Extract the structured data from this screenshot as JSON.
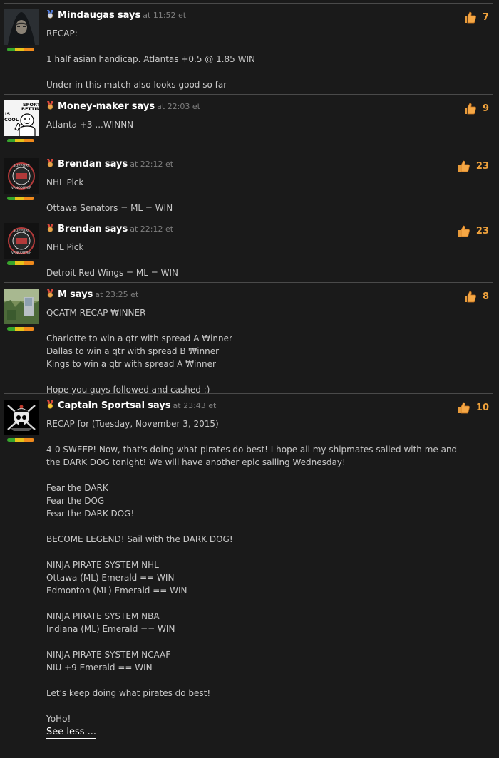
{
  "says_word": "says",
  "time_prefix": "at",
  "time_suffix": "et",
  "see_less_label": "See less ...",
  "colors": {
    "background": "#1a1a1a",
    "text": "#c9c9c9",
    "like_count": "#f0a23c",
    "rank_bar": [
      "#38a52c",
      "#e6c21a",
      "#f08a1c"
    ]
  },
  "comments": [
    {
      "author": "Mindaugas",
      "medal_icon": "silver-medal-icon",
      "time": "11:52",
      "likes": "7",
      "avatar_icon": "hooded-figure-avatar",
      "lines": [
        "RECAP:",
        "",
        "1 half asian handicap. Atlantas +0.5 @ 1.85 WIN",
        "",
        "Under in this match also looks good so far"
      ]
    },
    {
      "author": "Money-maker",
      "medal_icon": "bronze-medal-icon",
      "time": "22:03",
      "likes": "9",
      "avatar_icon": "sports-betting-cartoon-avatar",
      "avatar_text": [
        "SPORTS",
        "BETTING",
        "IS",
        "COOL"
      ],
      "lines": [
        "Atlanta +3 ...WINNN"
      ]
    },
    {
      "author": "Brendan",
      "medal_icon": "bronze-medal-icon",
      "time": "22:12",
      "likes": "23",
      "avatar_icon": "support-vancouver-badge-avatar",
      "lines": [
        "NHL Pick",
        "",
        "Ottawa Senators = ML = WIN"
      ]
    },
    {
      "author": "Brendan",
      "medal_icon": "bronze-medal-icon",
      "time": "22:12",
      "likes": "23",
      "avatar_icon": "support-vancouver-badge-avatar",
      "lines": [
        "NHL Pick",
        "",
        "Detroit Red Wings = ML = WIN"
      ]
    },
    {
      "author": "M",
      "medal_icon": "bronze-medal-icon",
      "time": "23:25",
      "likes": "8",
      "avatar_icon": "photo-avatar",
      "lines": [
        "QCATM RECAP ₩INNER",
        "",
        "Charlotte to win a qtr with spread A ₩inner",
        "Dallas to win a qtr with spread B ₩inner",
        "Kings to win a qtr with spread A ₩inner",
        "",
        "Hope you guys followed and cashed :)"
      ]
    },
    {
      "author": "Captain Sportsal",
      "medal_icon": "gold-medal-icon",
      "time": "23:43",
      "likes": "10",
      "avatar_icon": "pirate-skull-avatar",
      "lines": [
        "RECAP for (Tuesday, November 3, 2015)",
        "",
        "4-0 SWEEP! Now, that's doing what pirates do best! I hope all my shipmates sailed with me and",
        "the DARK DOG tonight! We will have another epic sailing Wednesday!",
        "",
        "Fear the DARK",
        "Fear the DOG",
        "Fear the DARK DOG!",
        "",
        "BECOME LEGEND! Sail with the DARK DOG!",
        "",
        "NINJA PIRATE SYSTEM NHL",
        "Ottawa (ML) Emerald == WIN",
        "Edmonton (ML) Emerald == WIN",
        "",
        "NINJA PIRATE SYSTEM NBA",
        "Indiana (ML) Emerald == WIN",
        "",
        "NINJA PIRATE SYSTEM NCAAF",
        "NIU +9 Emerald == WIN",
        "",
        "Let's keep doing what pirates do best!",
        "",
        "YoHo!"
      ],
      "show_see_less": true
    }
  ]
}
